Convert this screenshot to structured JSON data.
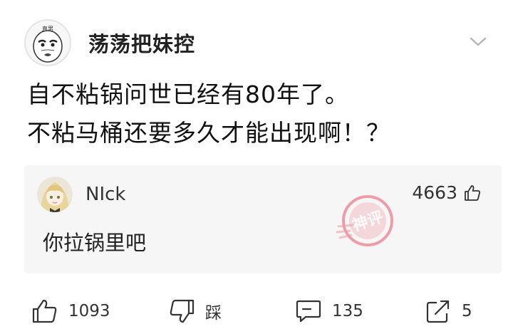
{
  "post": {
    "author": {
      "name": "荡荡把妹控",
      "avatar_icon": "meme-face-avatar",
      "avatar_caption": "直男"
    },
    "content_lines": [
      "自不粘锅问世已经有80年了。",
      "不粘马桶还要多久才能出现啊！？"
    ]
  },
  "reply": {
    "author": "NIck",
    "avatar_icon": "anime-girl-avatar",
    "likes": "4663",
    "text": "你拉锅里吧",
    "stamp_text": "神评"
  },
  "actions": {
    "like_count": "1093",
    "dislike_label": "踩",
    "comment_count": "135",
    "share_count": "5"
  },
  "colors": {
    "reply_bg": "#f6f6f6",
    "stamp": "#e8566a",
    "text": "#1a1a1a"
  }
}
